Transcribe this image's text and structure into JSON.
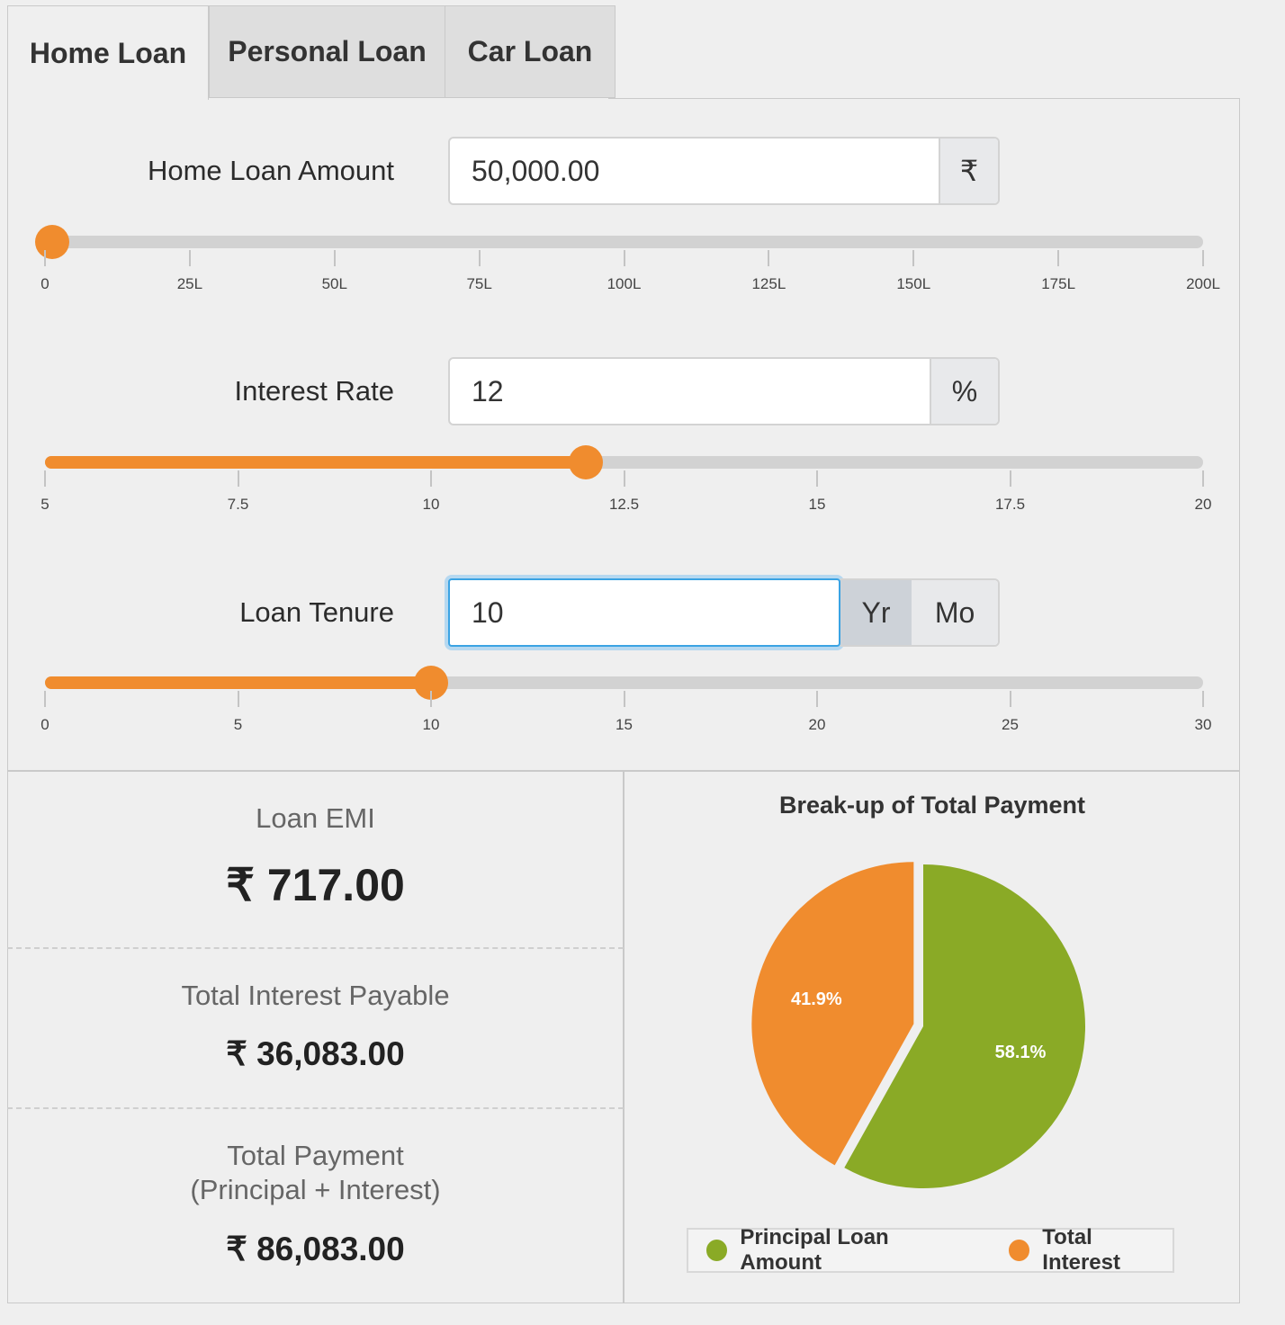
{
  "tabs": [
    {
      "label": "Home Loan",
      "active": true
    },
    {
      "label": "Personal Loan",
      "active": false
    },
    {
      "label": "Car Loan",
      "active": false
    }
  ],
  "inputs": {
    "amount": {
      "label": "Home Loan Amount",
      "value": "50,000.00",
      "addon": "₹"
    },
    "rate": {
      "label": "Interest Rate",
      "value": "12",
      "addon": "%"
    },
    "tenure": {
      "label": "Loan Tenure",
      "value": "10",
      "unit_year": "Yr",
      "unit_month": "Mo",
      "selected_unit": "Yr"
    }
  },
  "sliders": {
    "amount": {
      "min": 0,
      "max": 200,
      "value": 0.5,
      "ticks": [
        "0",
        "25L",
        "50L",
        "75L",
        "100L",
        "125L",
        "150L",
        "175L",
        "200L"
      ]
    },
    "rate": {
      "min": 5,
      "max": 20,
      "value": 12,
      "ticks": [
        "5",
        "7.5",
        "10",
        "12.5",
        "15",
        "17.5",
        "20"
      ]
    },
    "tenure": {
      "min": 0,
      "max": 30,
      "value": 10,
      "ticks": [
        "0",
        "5",
        "10",
        "15",
        "20",
        "25",
        "30"
      ]
    }
  },
  "results": {
    "emi_label": "Loan EMI",
    "emi_value": "₹ 717.00",
    "interest_label": "Total Interest Payable",
    "interest_value": "₹ 36,083.00",
    "payment_label_1": "Total Payment",
    "payment_label_2": "(Principal + Interest)",
    "payment_value": "₹ 86,083.00"
  },
  "chart_data": {
    "type": "pie",
    "title": "Break-up of Total Payment",
    "slices": [
      {
        "name": "Principal Loan Amount",
        "value": 58.1,
        "label": "58.1%",
        "color": "#8aaa26"
      },
      {
        "name": "Total Interest",
        "value": 41.9,
        "label": "41.9%",
        "color": "#f08c2e"
      }
    ],
    "legend_position": "bottom"
  },
  "colors": {
    "accent": "#f08c2e",
    "principal": "#8aaa26",
    "focus": "#3aa3e3"
  }
}
